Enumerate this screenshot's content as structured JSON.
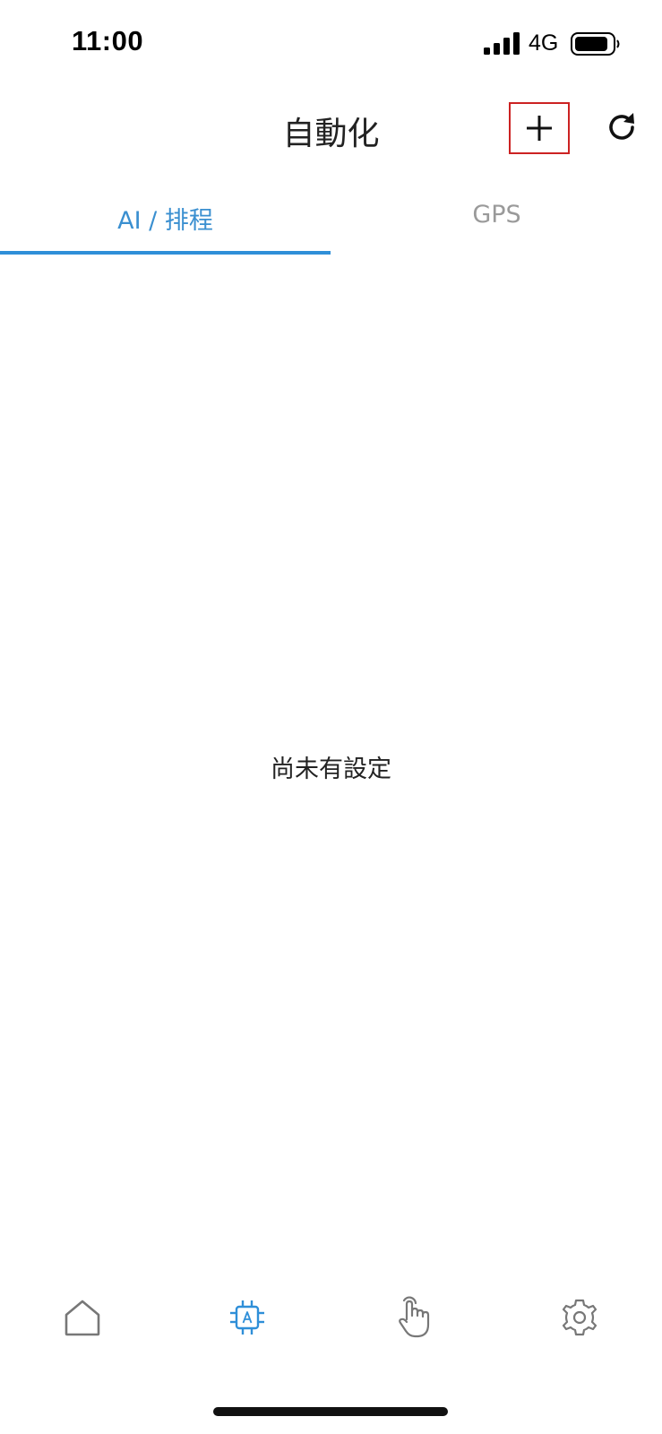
{
  "status_bar": {
    "time": "11:00",
    "network": "4G",
    "icons": [
      "signal-icon",
      "battery-icon"
    ]
  },
  "header": {
    "title": "自動化",
    "add_icon": "plus-icon",
    "refresh_icon": "refresh-icon"
  },
  "tabs": [
    {
      "label": "AI / 排程",
      "active": true
    },
    {
      "label": "GPS",
      "active": false
    }
  ],
  "main": {
    "empty_message": "尚未有設定"
  },
  "bottom_nav": {
    "items": [
      {
        "icon": "home-icon",
        "active": false
      },
      {
        "icon": "ai-chip-icon",
        "active": true
      },
      {
        "icon": "touch-hand-icon",
        "active": false
      },
      {
        "icon": "gear-icon",
        "active": false
      }
    ]
  },
  "colors": {
    "accent": "#2f8fd8",
    "inactive_tab": "#9a9a9a",
    "highlight_box": "#cc2222",
    "icon_gray": "#777777"
  }
}
